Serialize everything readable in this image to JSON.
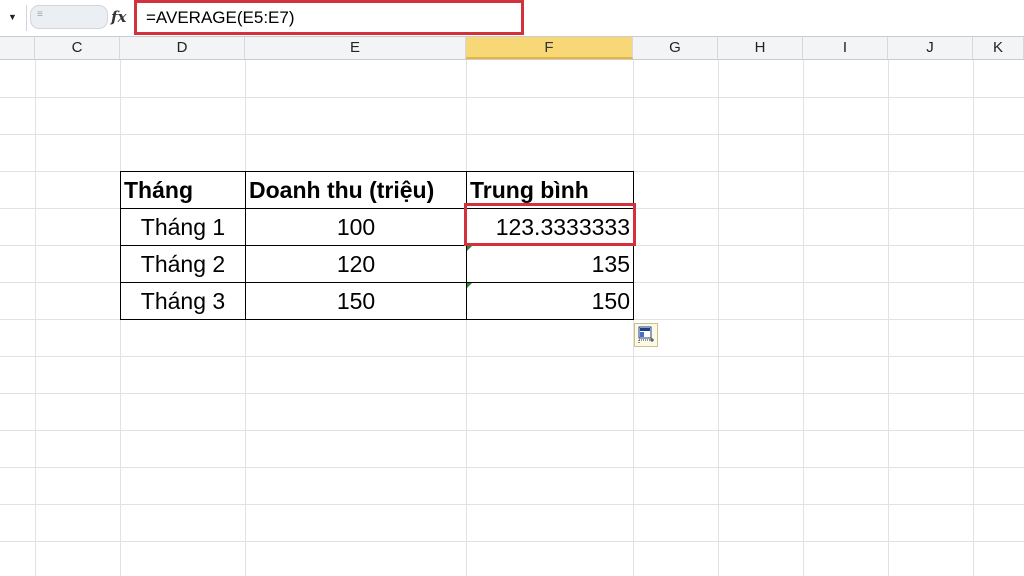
{
  "formula_bar": {
    "fx_label": "fx",
    "formula": "=AVERAGE(E5:E7)"
  },
  "columns": [
    {
      "letter": "C"
    },
    {
      "letter": "D"
    },
    {
      "letter": "E"
    },
    {
      "letter": "F",
      "active": true
    },
    {
      "letter": "G"
    },
    {
      "letter": "H"
    },
    {
      "letter": "I"
    },
    {
      "letter": "J"
    },
    {
      "letter": "K"
    }
  ],
  "table": {
    "headers": [
      "Tháng",
      "Doanh thu (triệu)",
      "Trung bình"
    ],
    "rows": [
      [
        "Tháng 1",
        "100",
        "123.3333333"
      ],
      [
        "Tháng 2",
        "120",
        "135"
      ],
      [
        "Tháng 3",
        "150",
        "150"
      ]
    ]
  },
  "colors": {
    "highlight_border": "#d1323b",
    "active_column_header": "#f8d776",
    "error_indicator": "#2a8a2a"
  },
  "icons": {
    "paste_options": "paste-options-icon"
  }
}
